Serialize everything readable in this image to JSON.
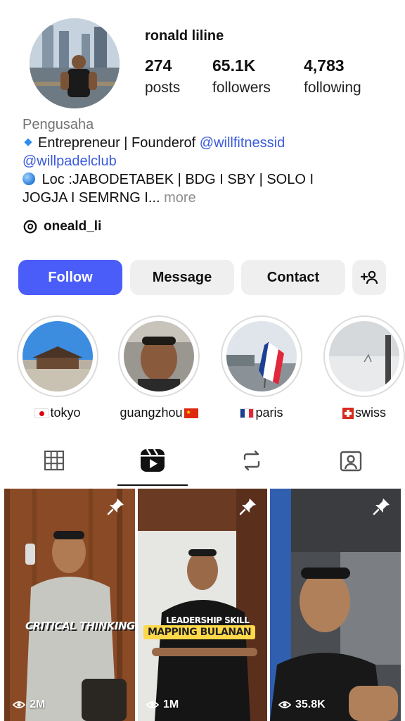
{
  "profile": {
    "username": "ronald liline",
    "stats": [
      {
        "value": "274",
        "label": "posts"
      },
      {
        "value": "65.1K",
        "label": "followers"
      },
      {
        "value": "4,783",
        "label": "following"
      }
    ]
  },
  "bio": {
    "category": "Pengusaha",
    "line1_text": "Entrepreneur | Founderof ",
    "mention1": "@willfitnessid",
    "mention2": "@willpadelclub",
    "line3": "Loc :JABODETABEK | BDG I SBY | SOLO I",
    "line4": "JOGJA I SEMRNG I...",
    "more": " more",
    "threads_handle": "oneald_li"
  },
  "actions": {
    "follow": "Follow",
    "message": "Message",
    "contact": "Contact"
  },
  "highlights": [
    {
      "label": "tokyo",
      "flag": "japan"
    },
    {
      "label": "guangzhou",
      "flag": "china"
    },
    {
      "label": "paris",
      "flag": "france"
    },
    {
      "label": "swiss",
      "flag": "switzerland"
    }
  ],
  "tabs": [
    "grid-icon",
    "reels-icon",
    "reposts-icon",
    "tagged-icon"
  ],
  "reels": [
    {
      "views": "2M",
      "overlay": "CRITICAL THINKING"
    },
    {
      "views": "1M",
      "overlay_top": "LEADERSHIP SKILL",
      "overlay_bottom": "MAPPING BULANAN"
    },
    {
      "views": "35.8K"
    }
  ],
  "colors": {
    "follow_button": "#4a5df9",
    "mention": "#3b5bdb",
    "secondary_button": "#efefef"
  }
}
